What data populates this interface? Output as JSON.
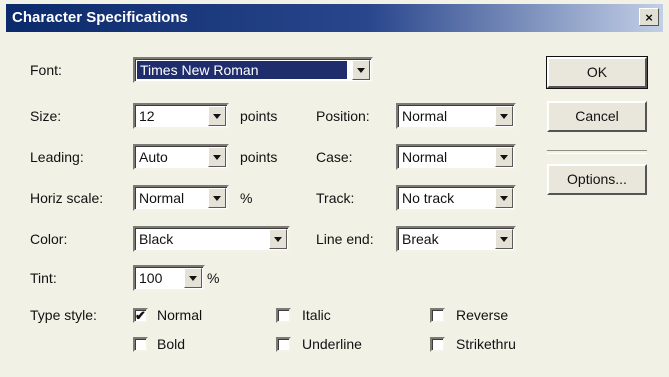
{
  "window": {
    "title": "Character Specifications",
    "close_label": "×"
  },
  "font": {
    "label": "Font:",
    "value": "Times New Roman"
  },
  "size": {
    "label": "Size:",
    "value": "12",
    "unit": "points"
  },
  "leading": {
    "label": "Leading:",
    "value": "Auto",
    "unit": "points"
  },
  "horiz_scale": {
    "label": "Horiz scale:",
    "value": "Normal",
    "unit": "%"
  },
  "color": {
    "label": "Color:",
    "value": "Black"
  },
  "tint": {
    "label": "Tint:",
    "value": "100",
    "unit": "%"
  },
  "position": {
    "label": "Position:",
    "value": "Normal"
  },
  "case": {
    "label": "Case:",
    "value": "Normal"
  },
  "track": {
    "label": "Track:",
    "value": "No track"
  },
  "line_end": {
    "label": "Line end:",
    "value": "Break"
  },
  "type_style": {
    "label": "Type style:",
    "normal": {
      "label": "Normal",
      "checked": true
    },
    "italic": {
      "label": "Italic",
      "checked": false
    },
    "reverse": {
      "label": "Reverse",
      "checked": false
    },
    "bold": {
      "label": "Bold",
      "checked": false
    },
    "underline": {
      "label": "Underline",
      "checked": false
    },
    "strikethru": {
      "label": "Strikethru",
      "checked": false
    }
  },
  "buttons": {
    "ok": "OK",
    "cancel": "Cancel",
    "options": "Options..."
  },
  "check_mark": "✔"
}
